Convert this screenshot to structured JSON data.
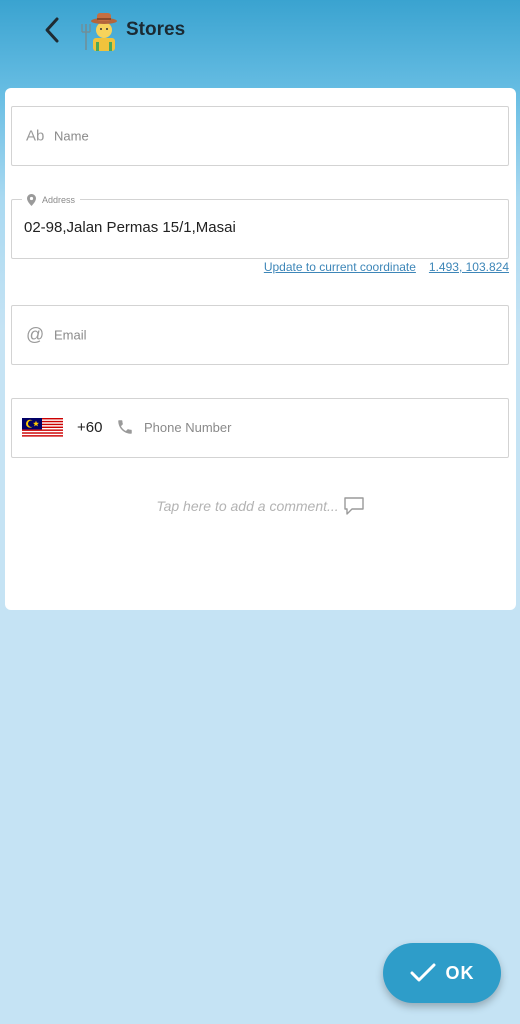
{
  "appbar": {
    "title": "Stores",
    "back_icon": "chevron-left-icon",
    "logo_icon": "farmer-avatar-icon"
  },
  "form": {
    "name": {
      "placeholder": "Name",
      "icon": "Ab"
    },
    "address": {
      "label": "Address",
      "value": "02-98,Jalan Permas 15/1,Masai",
      "icon": "map-pin-icon"
    },
    "coordinates": {
      "update_link": "Update to current coordinate",
      "value": "1.493, 103.824"
    },
    "email": {
      "placeholder": "Email",
      "icon": "@"
    },
    "phone": {
      "country_flag": "malaysia-flag-icon",
      "country_code": "+60",
      "placeholder": "Phone Number",
      "icon": "phone-icon"
    },
    "comment": {
      "placeholder": "Tap here to add a comment...",
      "icon": "speech-bubble-icon"
    }
  },
  "ok_button": {
    "label": "OK",
    "icon": "checkmark-icon"
  },
  "colors": {
    "accent": "#2e9dc9",
    "link": "#3d86b8",
    "header_top": "#3aa3d0",
    "background": "#c5e3f4"
  }
}
